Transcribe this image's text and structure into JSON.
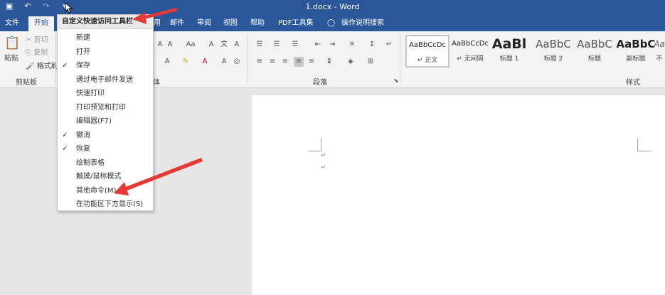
{
  "window": {
    "title": "1.docx - Word"
  },
  "qat": {
    "icons": [
      "save-icon",
      "undo-icon",
      "redo-icon",
      "customize-qat-icon"
    ],
    "undo_glyph": "↶",
    "redo_glyph": "↷",
    "save_glyph": "▣",
    "customize_glyph": "▾"
  },
  "tabs": [
    "文件",
    "开始",
    "用",
    "邮件",
    "审阅",
    "视图",
    "帮助",
    "PDF工具集",
    "操作说明搜索"
  ],
  "ribbon": {
    "clipboard": {
      "paste": "粘贴",
      "cut": "剪切",
      "copy": "复制",
      "format_painter": "格式刷",
      "group_label": "剪贴板"
    },
    "font": {
      "group_label": "体",
      "size_label": "Aa"
    },
    "paragraph": {
      "group_label": "段落"
    },
    "styles": {
      "group_label": "样式",
      "items": [
        {
          "sample": "AaBbCcDc",
          "name": "↵ 正文"
        },
        {
          "sample": "AaBbCcDc",
          "name": "↵ 无间隔"
        },
        {
          "sample": "AaBl",
          "name": "标题 1"
        },
        {
          "sample": "AaBbC",
          "name": "标题 2"
        },
        {
          "sample": "AaBbC",
          "name": "标题"
        },
        {
          "sample": "AaBbC",
          "name": "副标题"
        },
        {
          "sample": "Aa",
          "name": "不"
        }
      ]
    }
  },
  "menu": {
    "header": "自定义快速访问工具栏",
    "items": [
      {
        "label": "新建",
        "checked": false
      },
      {
        "label": "打开",
        "checked": false
      },
      {
        "label": "保存",
        "checked": true
      },
      {
        "label": "通过电子邮件发送",
        "checked": false
      },
      {
        "label": "快速打印",
        "checked": false
      },
      {
        "label": "打印预览和打印",
        "checked": false
      },
      {
        "label": "编辑器(F7)",
        "checked": false
      },
      {
        "label": "撤消",
        "checked": true
      },
      {
        "label": "恢复",
        "checked": true
      },
      {
        "label": "绘制表格",
        "checked": false
      },
      {
        "label": "触摸/鼠标模式",
        "checked": false
      },
      {
        "label": "其他命令(M)...",
        "checked": false
      },
      {
        "label": "在功能区下方显示(S)",
        "checked": false
      }
    ],
    "check_glyph": "✓"
  },
  "document": {
    "paragraph_mark": "↵"
  },
  "colors": {
    "title_bar": "#2b579a",
    "annotation_arrow": "#e53935"
  }
}
